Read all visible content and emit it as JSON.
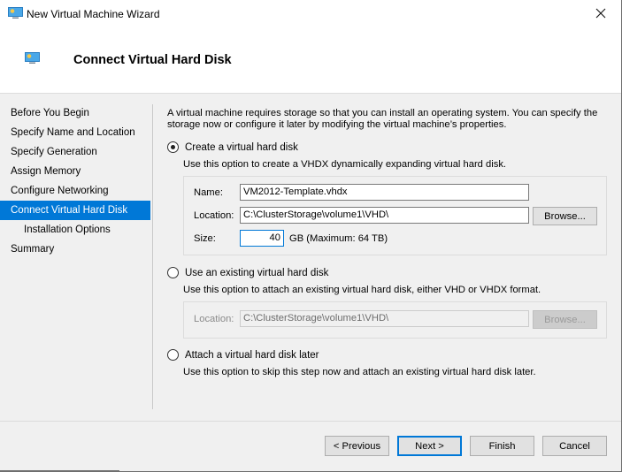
{
  "window": {
    "title": "New Virtual Machine Wizard",
    "app_icon": "virtual-machine-icon",
    "close_icon": "close-icon"
  },
  "header": {
    "title": "Connect Virtual Hard Disk",
    "icon": "virtual-machine-icon"
  },
  "sidebar": {
    "items": [
      {
        "label": "Before You Begin",
        "selected": false,
        "sub": false
      },
      {
        "label": "Specify Name and Location",
        "selected": false,
        "sub": false
      },
      {
        "label": "Specify Generation",
        "selected": false,
        "sub": false
      },
      {
        "label": "Assign Memory",
        "selected": false,
        "sub": false
      },
      {
        "label": "Configure Networking",
        "selected": false,
        "sub": false
      },
      {
        "label": "Connect Virtual Hard Disk",
        "selected": true,
        "sub": false
      },
      {
        "label": "Installation Options",
        "selected": false,
        "sub": true
      },
      {
        "label": "Summary",
        "selected": false,
        "sub": false
      }
    ],
    "selected_color": "#0078d7"
  },
  "main": {
    "intro_line1": "A virtual machine requires storage so that you can install an operating system. You can specify the",
    "intro_line2": "storage now or configure it later by modifying the virtual machine’s properties.",
    "options": {
      "create": {
        "label": "Create a virtual hard disk",
        "checked": true,
        "description": "Use this option to create a VHDX dynamically expanding virtual hard disk.",
        "name_label": "Name:",
        "name_value": "VM2012-Template.vhdx",
        "location_label": "Location:",
        "location_value": "C:\\ClusterStorage\\volume1\\VHD\\",
        "browse_label": "Browse...",
        "size_label": "Size:",
        "size_value": "40",
        "size_unit": "GB (Maximum: 64 TB)"
      },
      "existing": {
        "label": "Use an existing virtual hard disk",
        "checked": false,
        "description": "Use this option to attach an existing virtual hard disk, either VHD or VHDX format.",
        "location_label": "Location:",
        "location_value": "C:\\ClusterStorage\\volume1\\VHD\\",
        "browse_label": "Browse..."
      },
      "later": {
        "label": "Attach a virtual hard disk later",
        "checked": false,
        "description": "Use this option to skip this step now and attach an existing virtual hard disk later."
      }
    }
  },
  "footer": {
    "previous_label": "< Previous",
    "next_label": "Next >",
    "finish_label": "Finish",
    "cancel_label": "Cancel"
  }
}
